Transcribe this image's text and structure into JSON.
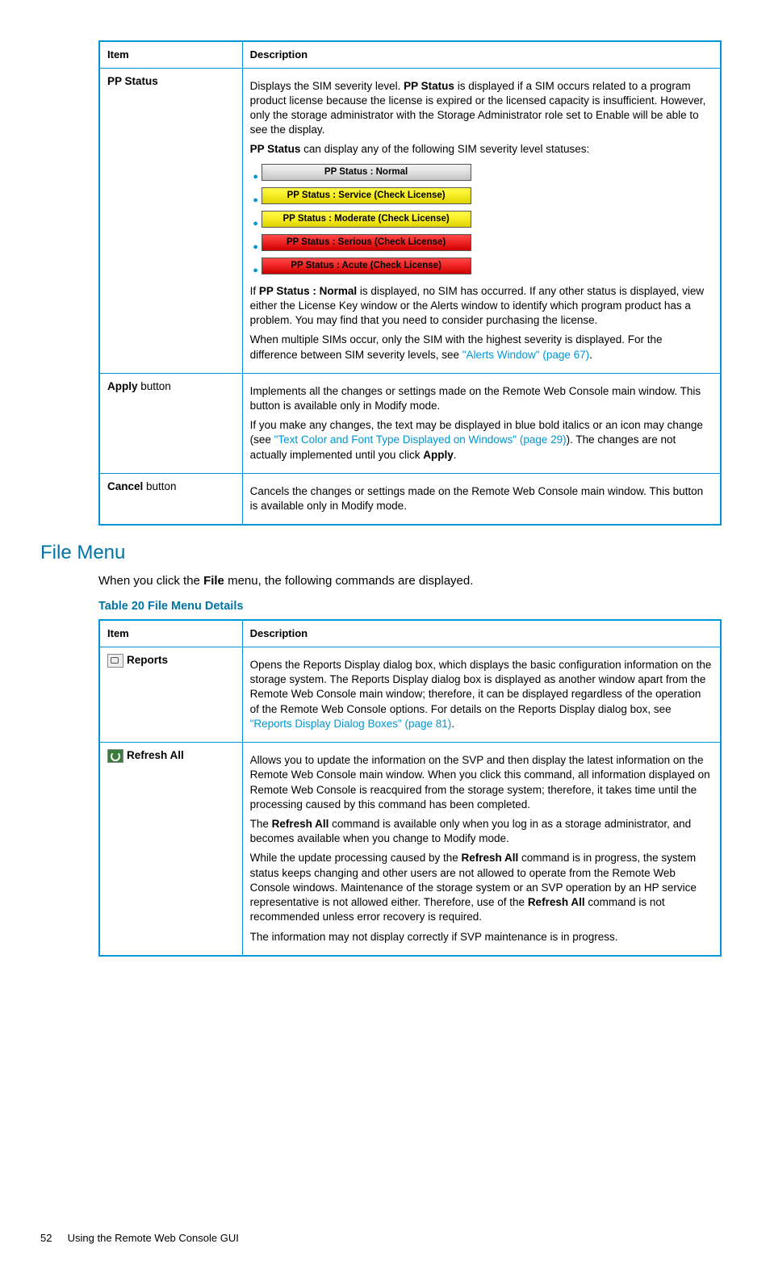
{
  "table1": {
    "headers": {
      "item": "Item",
      "desc": "Description"
    },
    "rows": {
      "pp": {
        "item": "PP Status",
        "p1a": "Displays the SIM severity level. ",
        "p1b": "PP Status",
        "p1c": " is displayed if a SIM occurs related to a program product license because the license is expired or the licensed capacity is insufficient. However, only the storage administrator with the Storage Administrator role set to Enable will be able to see the display.",
        "p2a": "PP Status",
        "p2b": " can display any of the following SIM severity level statuses:",
        "s1": "PP Status : Normal",
        "s2": "PP Status : Service (Check License)",
        "s3": "PP Status : Moderate (Check License)",
        "s4": "PP Status : Serious (Check License)",
        "s5": "PP Status : Acute (Check License)",
        "p3a": "If ",
        "p3b": "PP Status : Normal",
        "p3c": " is displayed, no SIM has occurred. If any other status is displayed, view either the License Key window or the Alerts window to identify which program product has a problem. You may find that you need to consider purchasing the license.",
        "p4a": "When multiple SIMs occur, only the SIM with the highest severity is displayed. For the difference between SIM severity levels, see ",
        "p4link": "\"Alerts Window\" (page 67)",
        "p4b": "."
      },
      "apply": {
        "item_b": "Apply",
        "item_t": " button",
        "p1": "Implements all the changes or settings made on the Remote Web Console main window. This button is available only in Modify mode.",
        "p2a": "If you make any changes, the text may be displayed in blue bold italics or an icon may change (see ",
        "p2link": "\"Text Color and Font Type Displayed on Windows\" (page 29)",
        "p2b": "). The changes are not actually implemented until you click ",
        "p2c": "Apply",
        "p2d": "."
      },
      "cancel": {
        "item_b": "Cancel",
        "item_t": " button",
        "p1": "Cancels the changes or settings made on the Remote Web Console main window. This button is available only in Modify mode."
      }
    }
  },
  "section": {
    "heading": "File Menu",
    "intro_a": "When you click the ",
    "intro_b": "File",
    "intro_c": " menu, the following commands are displayed.",
    "table_title": "Table 20 File Menu Details"
  },
  "table2": {
    "headers": {
      "item": "Item",
      "desc": "Description"
    },
    "rows": {
      "reports": {
        "label": "Reports",
        "p1a": "Opens the Reports Display dialog box, which displays the basic configuration information on the storage system. The Reports Display dialog box is displayed as another window apart from the Remote Web Console main window; therefore, it can be displayed regardless of the operation of the Remote Web Console options. For details on the Reports Display dialog box, see ",
        "p1link": "\"Reports Display Dialog Boxes\" (page 81)",
        "p1b": "."
      },
      "refresh": {
        "label": "Refresh All",
        "p1": "Allows you to update the information on the SVP and then display the latest information on the Remote Web Console main window. When you click this command, all information displayed on Remote Web Console is reacquired from the storage system; therefore, it takes time until the processing caused by this command has been completed.",
        "p2a": "The ",
        "p2b": "Refresh All",
        "p2c": " command is available only when you log in as a storage administrator, and becomes available when you change to Modify mode.",
        "p3a": "While the update processing caused by the ",
        "p3b": "Refresh All",
        "p3c": " command is in progress, the system status keeps changing and other users are not allowed to operate from the Remote Web Console windows. Maintenance of the storage system or an SVP operation by an HP service representative is not allowed either. Therefore, use of the ",
        "p3d": "Refresh All",
        "p3e": " command is not recommended unless error recovery is required.",
        "p4": "The information may not display correctly if SVP maintenance is in progress."
      }
    }
  },
  "footer": {
    "page": "52",
    "text": "Using the Remote Web Console GUI"
  }
}
